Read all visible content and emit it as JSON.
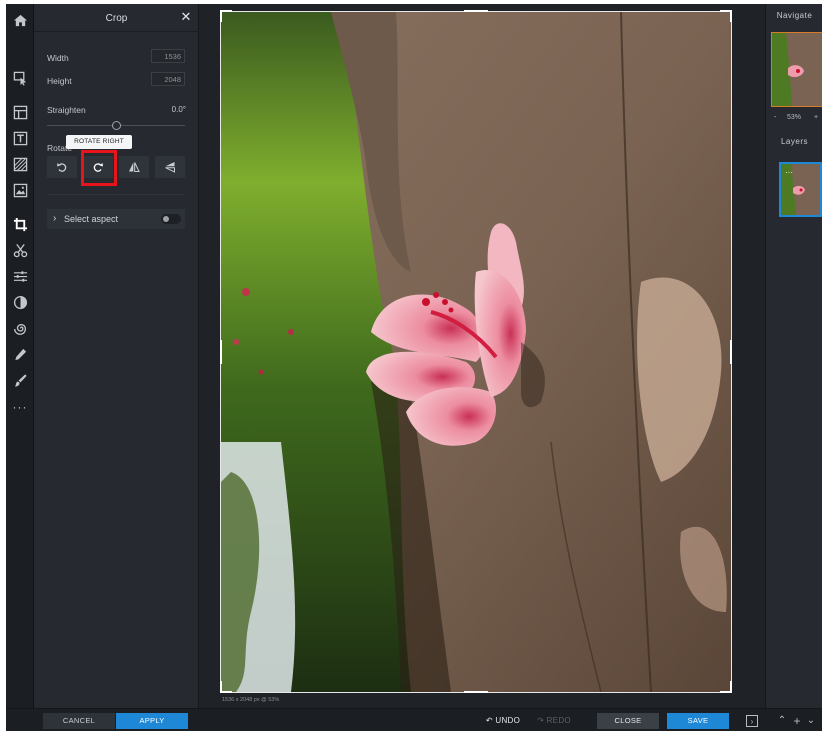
{
  "rail": {
    "icons": [
      "home-icon",
      "select-icon",
      "layout-icon",
      "text-icon",
      "texture-icon",
      "image-icon",
      "crop-icon",
      "cut-icon",
      "adjust-icon",
      "filter-icon",
      "liquify-icon",
      "pencil-icon",
      "brush-icon",
      "more-icon",
      "settings-icon"
    ],
    "more": "···"
  },
  "panel": {
    "title": "Crop",
    "width_label": "Width",
    "width_value": "1536",
    "height_label": "Height",
    "height_value": "2048",
    "straighten_label": "Straighten",
    "straighten_value": "0.0°",
    "rotate_label": "Rotate",
    "tooltip": "ROTATE RIGHT",
    "aspect_label": "Select aspect",
    "aspect_chevron": "›"
  },
  "bottom": {
    "cancel": "CANCEL",
    "apply": "APPLY",
    "undo": "↶ UNDO",
    "redo": "↷ REDO",
    "close": "CLOSE",
    "save": "SAVE",
    "status": "1536 x 2048 px @ 53%"
  },
  "right": {
    "navigate_title": "Navigate",
    "zoom_minus": "-",
    "zoom_value": "53%",
    "zoom_plus": "+",
    "layers_title": "Layers",
    "layer_dots": "···"
  },
  "colors": {
    "accent": "#1e88d6",
    "highlight": "#e8141b",
    "nav_border": "#d67c28"
  }
}
